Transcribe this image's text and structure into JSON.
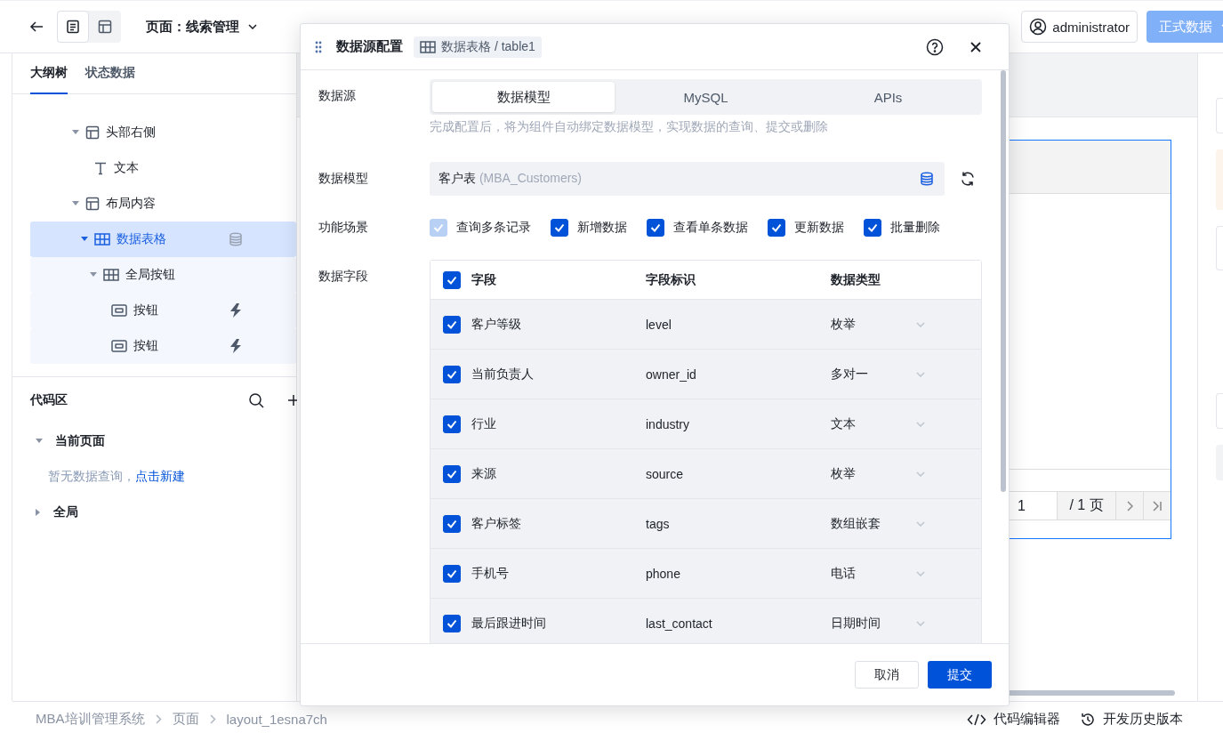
{
  "toolbar": {
    "views": [
      {
        "kind": "list",
        "selected": true
      },
      {
        "kind": "layout",
        "selected": false
      }
    ],
    "page_title": "页面：线索管理",
    "user": "administrator",
    "env_button": "正式数据"
  },
  "left_panel": {
    "tabs": [
      {
        "label": "大纲树",
        "selected": true
      },
      {
        "label": "状态数据",
        "selected": false
      }
    ],
    "tree": [
      {
        "label": "头部右侧",
        "kind": "layout",
        "expanded": true,
        "selected": false,
        "children": [
          {
            "label": "文本",
            "kind": "text",
            "selected": false
          }
        ]
      },
      {
        "label": "布局内容",
        "kind": "layout",
        "expanded": true,
        "selected": false,
        "children": [
          {
            "label": "数据表格",
            "kind": "table",
            "expanded": true,
            "selected": true,
            "bound_data": true,
            "children": [
              {
                "label": "全局按钮",
                "kind": "table",
                "expanded": true,
                "selected": false,
                "children": [
                  {
                    "label": "按钮",
                    "kind": "button",
                    "selected": false,
                    "has_event": true
                  },
                  {
                    "label": "按钮",
                    "kind": "button",
                    "selected": false,
                    "has_event": true
                  }
                ]
              }
            ]
          }
        ]
      }
    ],
    "code_area": {
      "title": "代码区",
      "groups": [
        {
          "label": "当前页面",
          "expanded": true,
          "empty_text": "暂无数据查询，",
          "link": "点击新建"
        },
        {
          "label": "全局",
          "expanded": false
        }
      ]
    }
  },
  "canvas": {
    "pagination": {
      "page": "1",
      "total": "/ 1 页"
    }
  },
  "breadcrumb": [
    "MBA培训管理系统",
    "页面",
    "layout_1esna7ch"
  ],
  "bottom_tools": [
    {
      "kind": "code",
      "label": "代码编辑器"
    },
    {
      "kind": "history",
      "label": "开发历史版本"
    }
  ],
  "dialog": {
    "title": "数据源配置",
    "tag": "数据表格 / table1",
    "source": {
      "label": "数据源",
      "options": [
        {
          "label": "数据模型",
          "selected": true
        },
        {
          "label": "MySQL",
          "selected": false
        },
        {
          "label": "APIs",
          "selected": false
        }
      ],
      "hint": "完成配置后，将为组件自动绑定数据模型，实现数据的查询、提交或删除"
    },
    "model": {
      "label": "数据模型",
      "value": "客户表",
      "code": "(MBA_Customers)"
    },
    "scenes": {
      "label": "功能场景",
      "items": [
        {
          "label": "查询多条记录",
          "checked": true,
          "disabled": true
        },
        {
          "label": "新增数据",
          "checked": true,
          "disabled": false
        },
        {
          "label": "查看单条数据",
          "checked": true,
          "disabled": false
        },
        {
          "label": "更新数据",
          "checked": true,
          "disabled": false
        },
        {
          "label": "批量删除",
          "checked": true,
          "disabled": false
        }
      ]
    },
    "fields": {
      "label": "数据字段",
      "all_checked": true,
      "columns": [
        "字段",
        "字段标识",
        "数据类型"
      ],
      "rows": [
        {
          "name": "客户等级",
          "key": "level",
          "type": "枚举",
          "checked": true
        },
        {
          "name": "当前负责人",
          "key": "owner_id",
          "type": "多对一",
          "checked": true
        },
        {
          "name": "行业",
          "key": "industry",
          "type": "文本",
          "checked": true
        },
        {
          "name": "来源",
          "key": "source",
          "type": "枚举",
          "checked": true
        },
        {
          "name": "客户标签",
          "key": "tags",
          "type": "数组嵌套",
          "checked": true
        },
        {
          "name": "手机号",
          "key": "phone",
          "type": "电话",
          "checked": true
        },
        {
          "name": "最后跟进时间",
          "key": "last_contact",
          "type": "日期时间",
          "checked": true
        }
      ]
    },
    "buttons": {
      "cancel": "取消",
      "submit": "提交"
    }
  }
}
